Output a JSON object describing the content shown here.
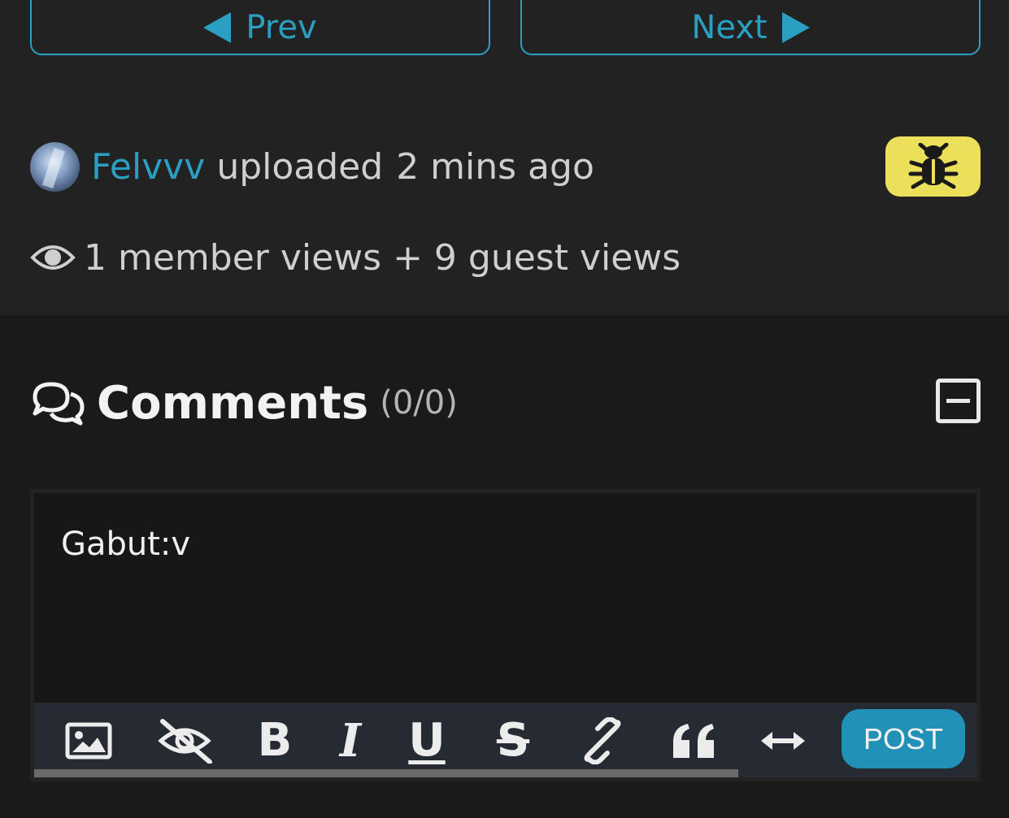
{
  "nav": {
    "prev_label": "Prev",
    "next_label": "Next"
  },
  "upload_info": {
    "uploader": "Felvvv",
    "action": "uploaded",
    "time": "2 mins ago"
  },
  "views": {
    "text": "1 member views + 9 guest views"
  },
  "comments": {
    "title": "Comments",
    "count": "(0/0)"
  },
  "editor": {
    "content": "Gabut:v",
    "post_label": "POST",
    "toolbar_icons": [
      "image-icon",
      "eye-slash-icon",
      "bold-icon",
      "italic-icon",
      "underline-icon",
      "strikethrough-icon",
      "link-icon",
      "quote-icon",
      "resize-arrows-icon"
    ]
  },
  "colors": {
    "accent": "#2b9fc1",
    "bug_button": "#ece05a",
    "post_button": "#2191b8"
  }
}
